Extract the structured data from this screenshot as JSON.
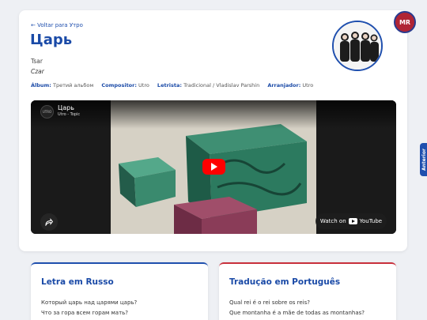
{
  "song": {
    "back_link": "← Voltar para Утро",
    "title": "Царь",
    "transliteration": "Tsar",
    "translation": "Czar"
  },
  "meta": [
    {
      "label": "Álbum:",
      "value": "Третий альбом"
    },
    {
      "label": "Compositor:",
      "value": "Utro"
    },
    {
      "label": "Letrista:",
      "value": "Tradicional / Vladislav Parshin"
    },
    {
      "label": "Arranjador:",
      "value": "Utro"
    }
  ],
  "video": {
    "title": "Царь",
    "channel": "Utro - Topic",
    "channel_avatar_text": "UTRO",
    "watch_on": "Watch on",
    "youtube": "YouTube"
  },
  "site_badge": "MR",
  "side_tab": "Anterior",
  "lyrics_ru": {
    "title": "Letra em Russo",
    "lines": [
      "Который царь над царями царь?",
      "Что за гора всем горам мать?"
    ]
  },
  "lyrics_pt": {
    "title": "Tradução em Português",
    "lines": [
      "Qual rei é o rei sobre os reis?",
      "Que montanha é a mãe de todas as montanhas?"
    ]
  },
  "colors": {
    "accent": "#1f4fae",
    "title": "#1a4aa7",
    "red_accent": "#c8303c",
    "youtube_red": "#ff0000"
  }
}
